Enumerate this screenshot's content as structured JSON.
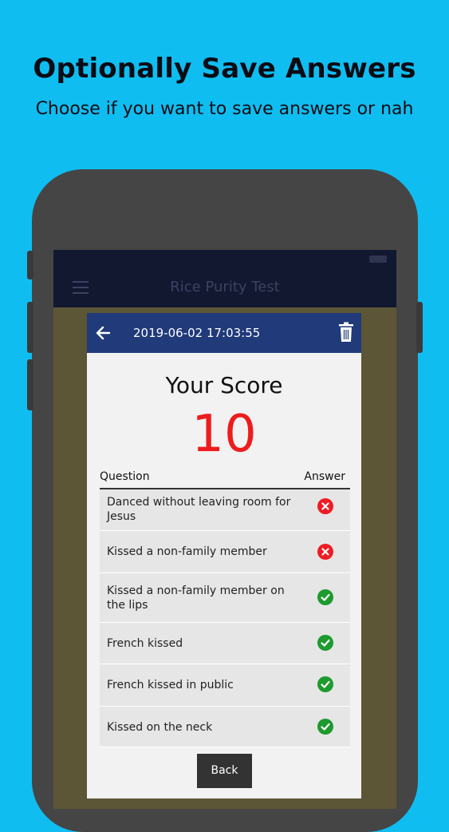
{
  "promo": {
    "headline": "Optionally Save Answers",
    "subhead": "Choose if you want to save answers or nah"
  },
  "app": {
    "title": "Rice Purity Test"
  },
  "modal": {
    "date": "2019-06-02 17:03:55",
    "score_label": "Your Score",
    "score_value": "10",
    "col_question": "Question",
    "col_answer": "Answer",
    "rows": [
      {
        "question": "Danced without leaving room for Jesus",
        "answer": "x-icon"
      },
      {
        "question": "Kissed a non-family member",
        "answer": "x-icon"
      },
      {
        "question": "Kissed a non-family member on the lips",
        "answer": "check-icon"
      },
      {
        "question": "French kissed",
        "answer": "check-icon"
      },
      {
        "question": "French kissed in public",
        "answer": "check-icon"
      },
      {
        "question": "Kissed on the neck",
        "answer": "check-icon"
      }
    ],
    "back_label": "Back"
  },
  "colors": {
    "background": "#10bdf0",
    "modal_header": "#203a7a",
    "score": "#ee1c1c",
    "wrong": "#ee1c24",
    "right": "#1e9a2e"
  }
}
